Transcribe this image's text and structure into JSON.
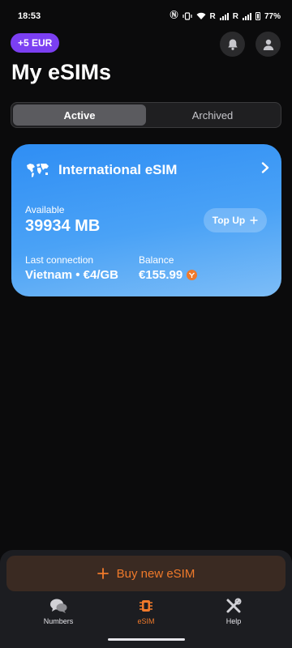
{
  "status_bar": {
    "time": "18:53",
    "icons": [
      "nfc-icon",
      "vibrate-icon",
      "wifi-icon",
      "signal-icon",
      "signal-icon",
      "battery-icon"
    ],
    "roaming_label_1": "R",
    "roaming_label_2": "R",
    "battery": "77%"
  },
  "header": {
    "promo_badge": "+5 EUR",
    "title": "My eSIMs",
    "icons": [
      "bell-icon",
      "profile-icon"
    ]
  },
  "tabs": [
    {
      "label": "Active",
      "selected": true
    },
    {
      "label": "Archived",
      "selected": false
    }
  ],
  "esim_card": {
    "icon": "world-map-icon",
    "title": "International eSIM",
    "available_label": "Available",
    "available_value": "39934 MB",
    "topup_label": "Top Up",
    "last_connection_label": "Last connection",
    "last_connection_value": "Vietnam • €4/GB",
    "balance_label": "Balance",
    "balance_value": "€155.99",
    "colors": {
      "gradient_start": "#2f8ef4",
      "gradient_end": "#7dbdf7"
    }
  },
  "buy_button": {
    "label": "Buy new eSIM",
    "icon": "plus-icon",
    "color": "#f07a2b"
  },
  "nav": [
    {
      "label": "Numbers",
      "icon": "chat-bubbles-icon",
      "active": false
    },
    {
      "label": "eSIM",
      "icon": "chip-icon",
      "active": true
    },
    {
      "label": "Help",
      "icon": "tools-icon",
      "active": false
    }
  ],
  "colors": {
    "accent": "#f07a2b",
    "promo": "#7b3ff2",
    "background": "#0b0b0c"
  }
}
